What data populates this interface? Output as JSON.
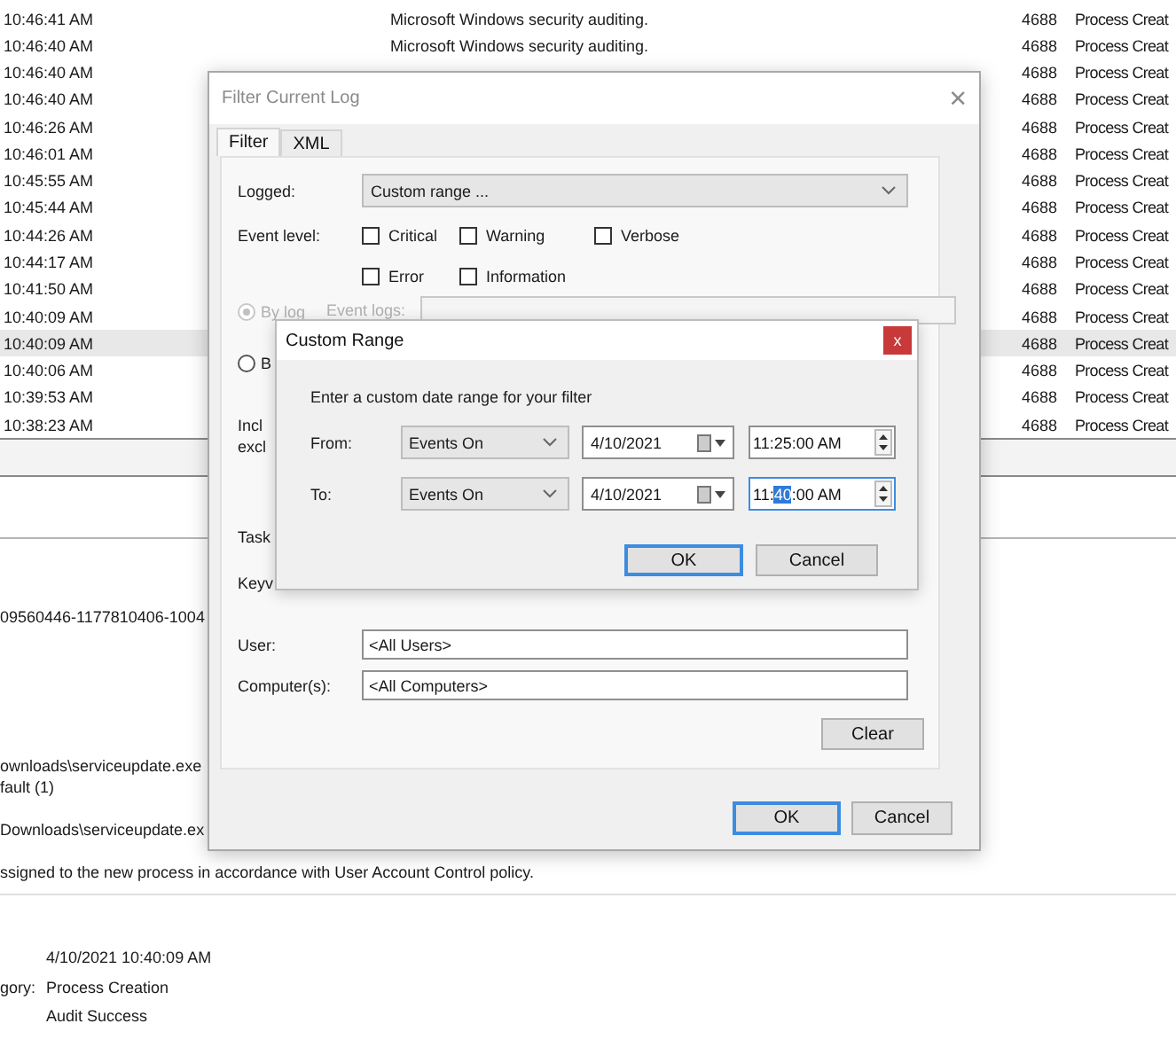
{
  "event_list": {
    "rows": [
      {
        "time": "10:46:41 AM",
        "source": "Microsoft Windows security auditing.",
        "event_id": "4688",
        "task": "Process Creat",
        "selected": false
      },
      {
        "time": "10:46:40 AM",
        "source": "Microsoft Windows security auditing.",
        "event_id": "4688",
        "task": "Process Creat",
        "selected": false
      },
      {
        "time": "10:46:40 AM",
        "event_id": "4688",
        "task": "Process Creat",
        "selected": false
      },
      {
        "time": "10:46:40 AM",
        "event_id": "4688",
        "task": "Process Creat",
        "selected": false
      },
      {
        "time": "10:46:26 AM",
        "event_id": "4688",
        "task": "Process Creat",
        "selected": false
      },
      {
        "time": "10:46:01 AM",
        "event_id": "4688",
        "task": "Process Creat",
        "selected": false
      },
      {
        "time": "10:45:55 AM",
        "event_id": "4688",
        "task": "Process Creat",
        "selected": false
      },
      {
        "time": "10:45:44 AM",
        "event_id": "4688",
        "task": "Process Creat",
        "selected": false
      },
      {
        "time": "10:44:26 AM",
        "event_id": "4688",
        "task": "Process Creat",
        "selected": false
      },
      {
        "time": "10:44:17 AM",
        "event_id": "4688",
        "task": "Process Creat",
        "selected": false
      },
      {
        "time": "10:41:50 AM",
        "event_id": "4688",
        "task": "Process Creat",
        "selected": false
      },
      {
        "time": "10:40:09 AM",
        "event_id": "4688",
        "task": "Process Creat",
        "selected": false
      },
      {
        "time": "10:40:09 AM",
        "event_id": "4688",
        "task": "Process Creat",
        "selected": true
      },
      {
        "time": "10:40:06 AM",
        "event_id": "4688",
        "task": "Process Creat",
        "selected": false
      },
      {
        "time": "10:39:53 AM",
        "event_id": "4688",
        "task": "Process Creat",
        "selected": false
      },
      {
        "time": "10:38:23 AM",
        "event_id": "4688",
        "task": "Process Creat",
        "selected": false
      }
    ]
  },
  "details": {
    "account_sid": "09560446-1177810406-1004",
    "process_lines": [
      "ownloads\\serviceupdate.exe",
      "fault (1)",
      "Downloads\\serviceupdate.ex"
    ],
    "note": "ssigned to the new process in accordance with User Account Control policy.",
    "logged": "4/10/2021 10:40:09 AM",
    "task_category": {
      "label": "gory:",
      "value": "Process Creation"
    },
    "keywords": "Audit Success"
  },
  "filter_dialog": {
    "title": "Filter Current Log",
    "close": "×",
    "tabs": [
      {
        "label": "Filter",
        "selected": true
      },
      {
        "label": "XML",
        "selected": false
      }
    ],
    "logged": {
      "label": "Logged:",
      "value": "Custom range ..."
    },
    "event_level": {
      "label": "Event level:",
      "options": [
        {
          "label": "Critical",
          "checked": false
        },
        {
          "label": "Warning",
          "checked": false
        },
        {
          "label": "Verbose",
          "checked": false
        },
        {
          "label": "Error",
          "checked": false
        },
        {
          "label": "Information",
          "checked": false
        }
      ]
    },
    "source_mode": [
      {
        "label": "By log",
        "selected": true,
        "disabled": true
      },
      {
        "label": "B",
        "selected": false,
        "disabled": false
      }
    ],
    "event_logs_label": "Event logs:",
    "cut_labels": [
      "Incl",
      "excl",
      "Task",
      "Keyv"
    ],
    "user": {
      "label": "User:",
      "value": "<All Users>"
    },
    "computer": {
      "label": "Computer(s):",
      "value": "<All Computers>"
    },
    "clear": "Clear",
    "ok": "OK",
    "cancel": "Cancel"
  },
  "custom_range": {
    "title": "Custom Range",
    "close": "x",
    "prompt": "Enter a custom date range for your filter",
    "rows": [
      {
        "label": "From:",
        "mode": "Events On",
        "date": "4/10/2021",
        "time": [
          {
            "text": "11:25:00 AM",
            "selected": false
          }
        ]
      },
      {
        "label": "To:",
        "mode": "Events On",
        "date": "4/10/2021",
        "time": [
          {
            "text": "11:",
            "selected": false
          },
          {
            "text": "40",
            "selected": true
          },
          {
            "text": ":00 AM",
            "selected": false
          }
        ]
      }
    ],
    "ok": "OK",
    "cancel": "Cancel"
  }
}
